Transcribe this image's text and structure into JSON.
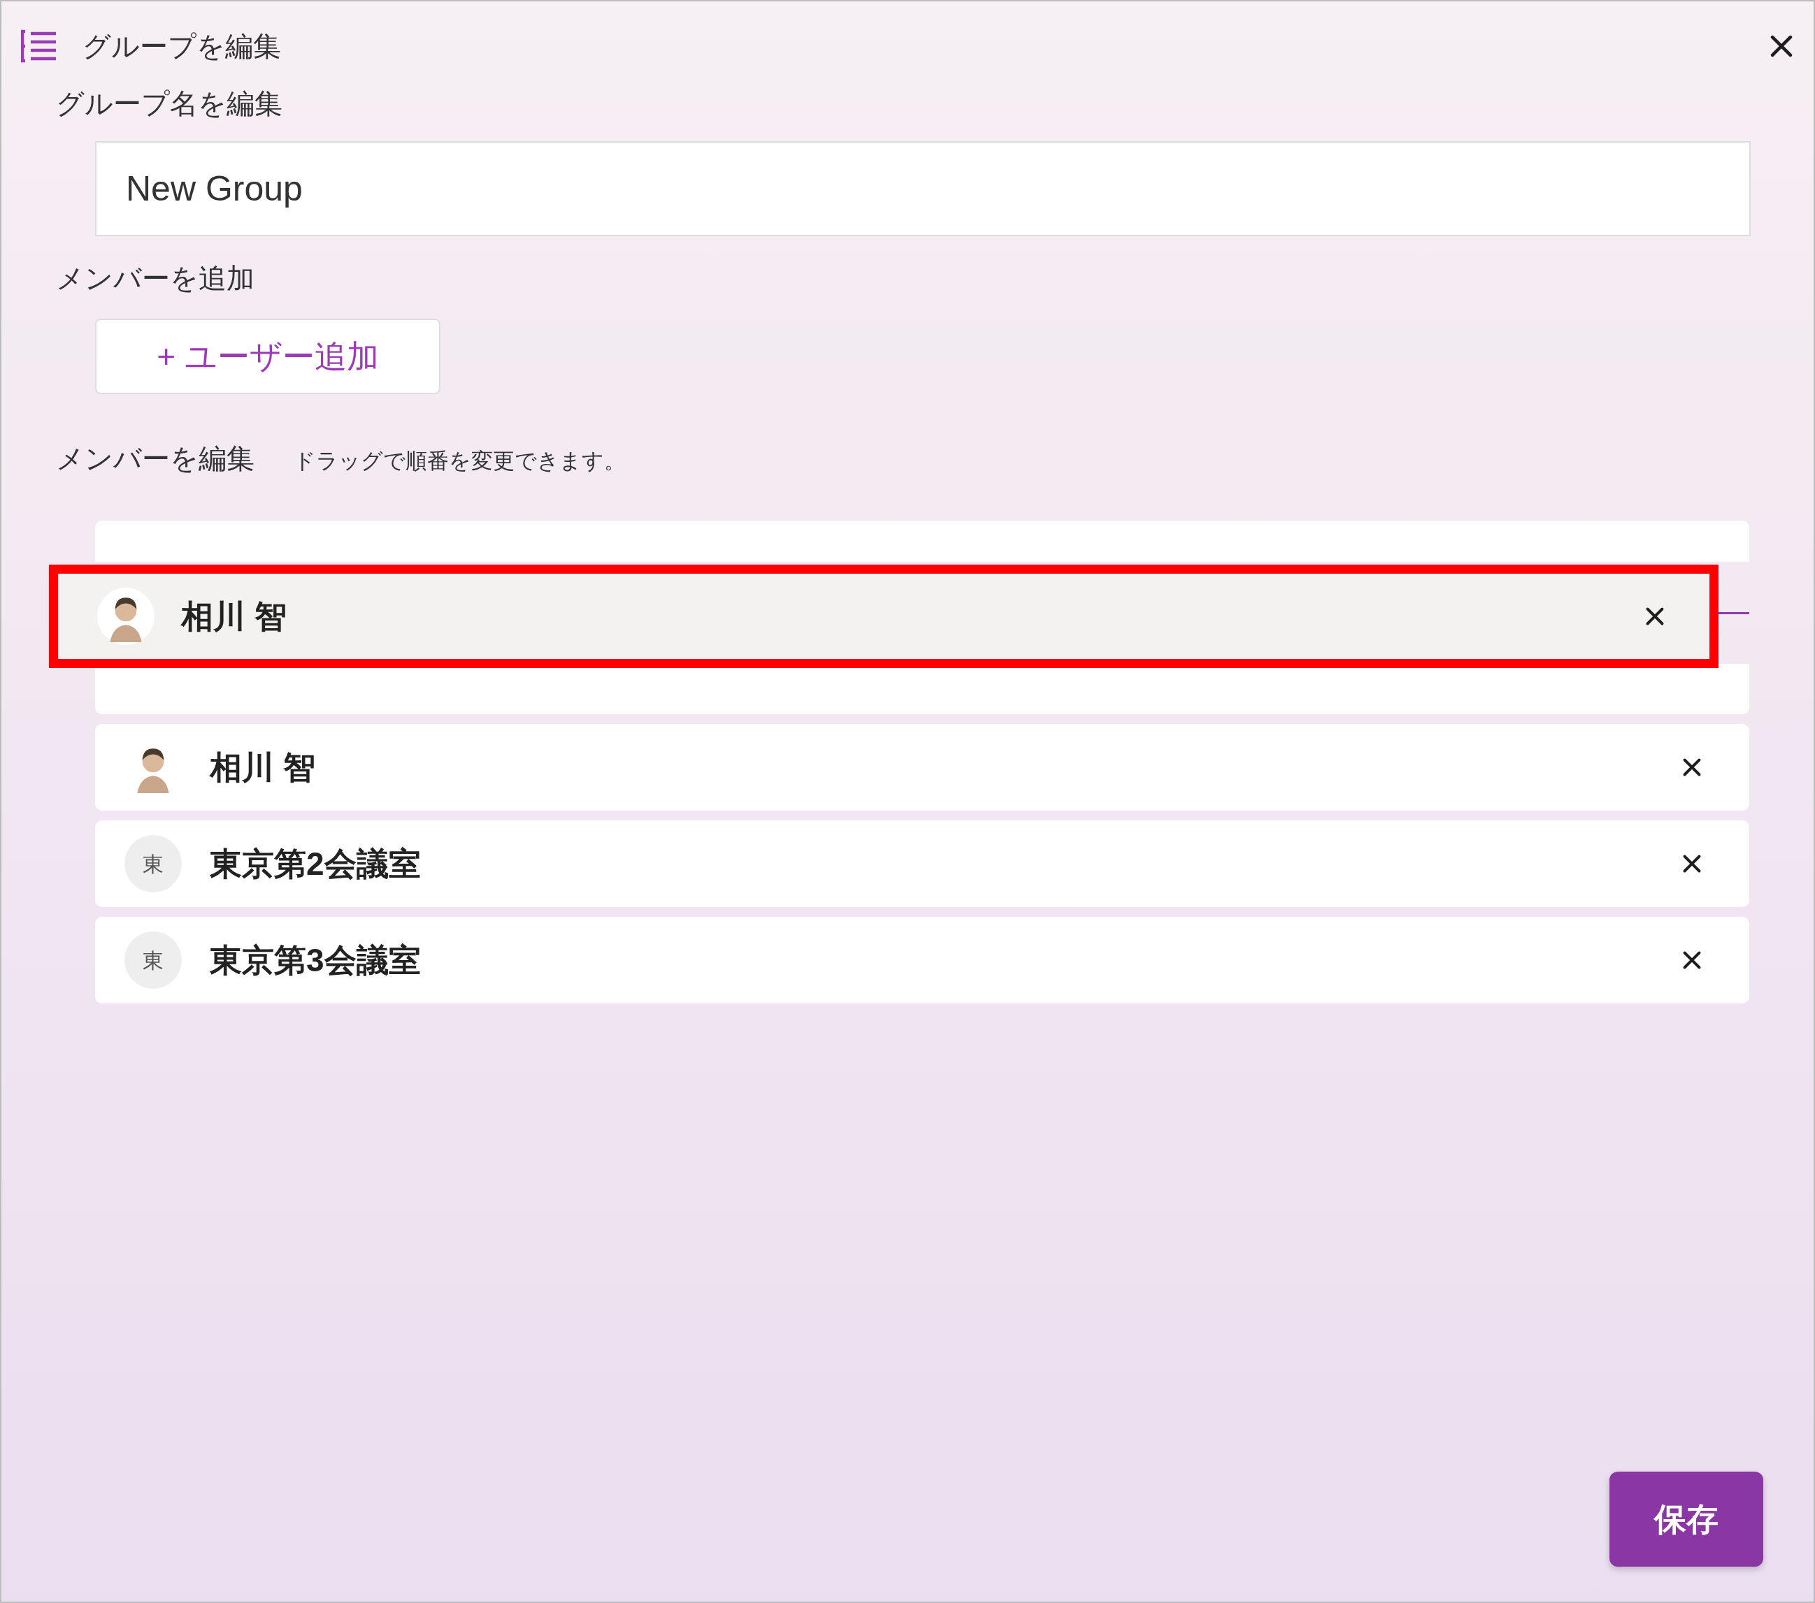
{
  "dialog": {
    "title": "グループを編集"
  },
  "group_name": {
    "label": "グループ名を編集",
    "value": "New Group"
  },
  "add_members": {
    "label": "メンバーを追加",
    "button": "+ ユーザー追加"
  },
  "edit_members": {
    "label": "メンバーを編集",
    "hint": "ドラッグで順番を変更できます。"
  },
  "members": [
    {
      "kind": "top_part",
      "drop_line_below": true
    },
    {
      "kind": "bottom_part",
      "drop_line_below": false
    },
    {
      "kind": "full",
      "name": "相川 智",
      "avatar": {
        "kind": "photo"
      },
      "drop_line_below": false
    },
    {
      "kind": "full",
      "name": "東京第2会議室",
      "avatar": {
        "kind": "initial",
        "text": "東"
      },
      "drop_line_below": false
    },
    {
      "kind": "full",
      "name": "東京第3会議室",
      "avatar": {
        "kind": "initial",
        "text": "東"
      },
      "drop_line_below": false
    }
  ],
  "dragging": {
    "name": "相川 智",
    "avatar": {
      "kind": "photo"
    },
    "highlighted": true
  },
  "save_button": "保存"
}
